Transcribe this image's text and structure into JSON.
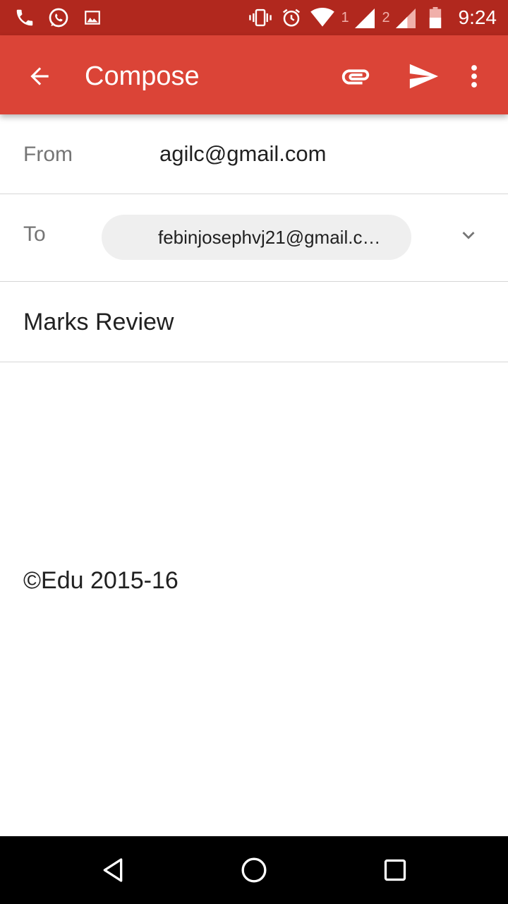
{
  "status_bar": {
    "time": "9:24",
    "sim1_label": "1",
    "sim2_label": "2",
    "left_icons": [
      "phone-icon",
      "whatsapp-icon",
      "image-icon"
    ],
    "right_icons": [
      "vibrate-icon",
      "alarm-icon",
      "wifi-icon",
      "signal-icon",
      "battery-icon"
    ],
    "background": "#b1281e"
  },
  "app_bar": {
    "title": "Compose",
    "background": "#db4437",
    "actions": [
      "attach-icon",
      "send-icon",
      "more-icon"
    ]
  },
  "form": {
    "from_label": "From",
    "from_value": "agilc@gmail.com",
    "to_label": "To",
    "to_chip": "febinjosephvj21@gmail.c…",
    "subject": "Marks Review",
    "body_signature": "©Edu 2015-16"
  },
  "nav_bar": {
    "buttons": [
      "back-triangle-icon",
      "home-circle-icon",
      "recents-square-icon"
    ]
  }
}
